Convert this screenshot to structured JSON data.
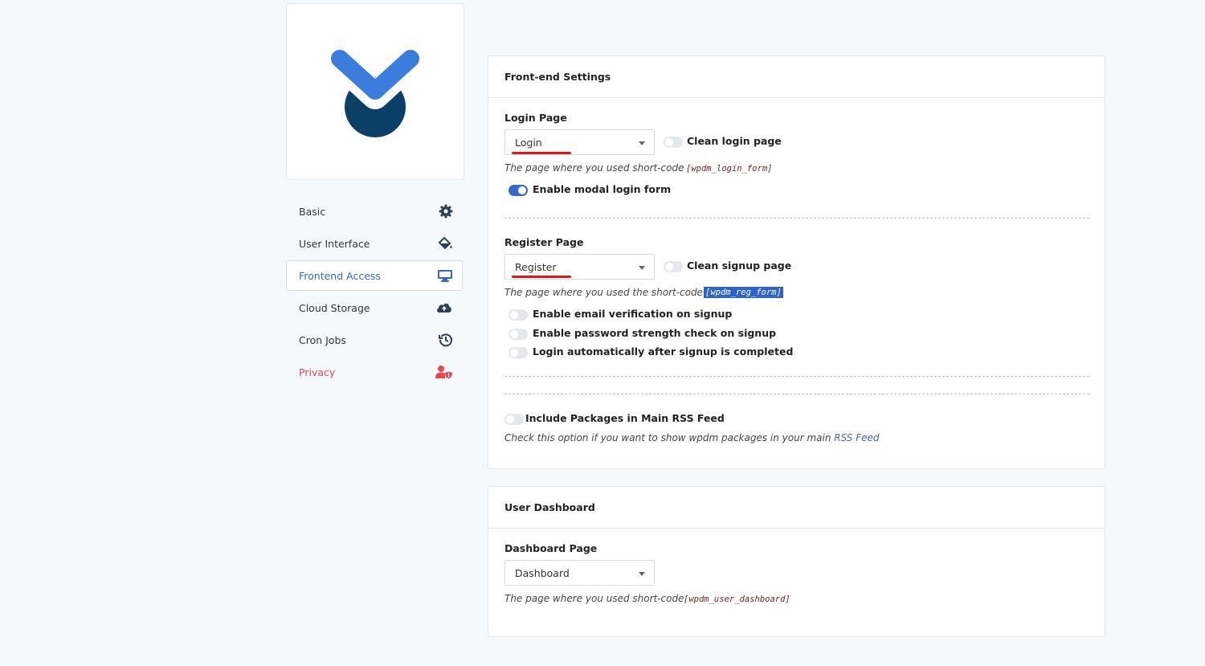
{
  "sidebar": {
    "items": [
      {
        "label": "Basic",
        "icon": "gear-icon"
      },
      {
        "label": "User Interface",
        "icon": "paint-bucket-icon"
      },
      {
        "label": "Frontend Access",
        "icon": "monitor-icon"
      },
      {
        "label": "Cloud Storage",
        "icon": "cloud-upload-icon"
      },
      {
        "label": "Cron Jobs",
        "icon": "history-icon"
      },
      {
        "label": "Privacy",
        "icon": "user-shield-icon"
      }
    ],
    "active": "Frontend Access"
  },
  "frontend": {
    "title": "Front-end Settings",
    "login_label": "Login Page",
    "login_value": "Login",
    "clean_login": "Clean login page",
    "login_hint": "The page where you used short-code",
    "login_code": "[wpdm_login_form]",
    "modal_login": "Enable modal login form",
    "register_label": "Register Page",
    "register_value": "Register",
    "clean_signup": "Clean signup page",
    "register_hint": "The page where you used the short-code",
    "register_code": "[wpdm_reg_form]",
    "email_verification": "Enable email verification on signup",
    "password_strength": "Enable password strength check on signup",
    "auto_login": "Login automatically after signup is completed",
    "rss_label": "Include Packages in Main RSS Feed",
    "rss_hint": "Check this option if you want to show wpdm packages in your main",
    "rss_link": "RSS Feed"
  },
  "dashboard": {
    "title": "User Dashboard",
    "page_label": "Dashboard Page",
    "page_value": "Dashboard",
    "hint": "The page where you used short-code",
    "code": "[wpdm_user_dashboard]"
  },
  "colors": {
    "accent": "#3567c8",
    "brand_light": "#3b7ddd",
    "brand_dark": "#0c3f66",
    "danger": "#e8454f"
  }
}
